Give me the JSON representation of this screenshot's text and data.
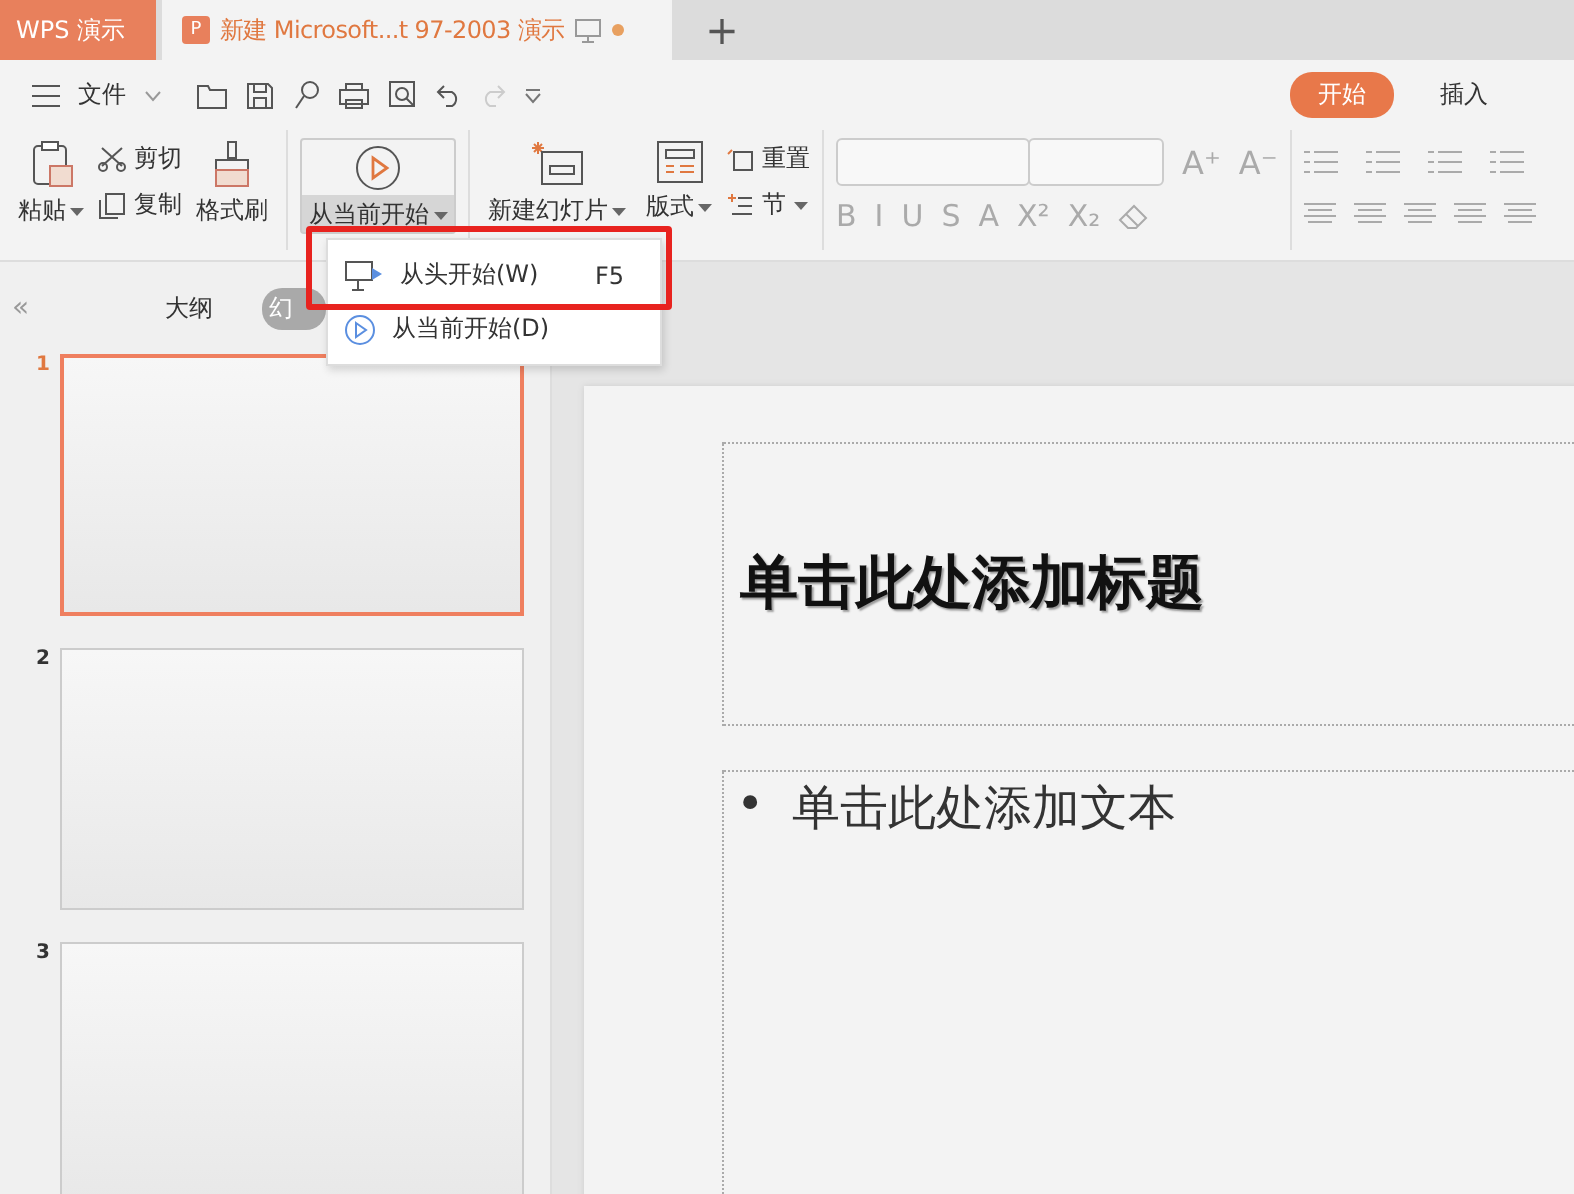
{
  "app_tab": {
    "label": "WPS 演示"
  },
  "doc_tab": {
    "icon": "P",
    "label": "新建 Microsoft...t 97-2003 演示",
    "modified": true
  },
  "new_tab": {
    "label": "+"
  },
  "file_menu": {
    "label": "文件"
  },
  "ribbon_tabs": [
    {
      "label": "开始",
      "selected": true
    },
    {
      "label": "插入",
      "selected": false
    }
  ],
  "ribbon": {
    "paste": "粘贴",
    "cut": "剪切",
    "copy": "复制",
    "format_painter": "格式刷",
    "play": {
      "label": "从当前开始",
      "pressed": true
    },
    "new_slide": "新建幻灯片",
    "layout": "版式",
    "reset": "重置",
    "section": "节"
  },
  "font_buttons": [
    "A⁺",
    "A⁻"
  ],
  "format_buttons": [
    "B",
    "I",
    "U",
    "S",
    "A",
    "X²",
    "X₂"
  ],
  "slideshow_menu": [
    {
      "kind": "from-start",
      "label": "从头开始(W)",
      "shortcut": "F5",
      "annotated": true
    },
    {
      "kind": "from-current",
      "label": "从当前开始(D)",
      "annotated": false
    }
  ],
  "panel_tabs": [
    {
      "label": "大纲",
      "selected": false
    },
    {
      "label": "幻",
      "selected": true
    }
  ],
  "panel_collapse": "«",
  "slides": [
    {
      "number": "1",
      "selected": true
    },
    {
      "number": "2",
      "selected": false
    },
    {
      "number": "3",
      "selected": false
    }
  ],
  "slide": {
    "title_placeholder": "单击此处添加标题",
    "bullet": "•",
    "body_placeholder": "单击此处添加文本"
  }
}
